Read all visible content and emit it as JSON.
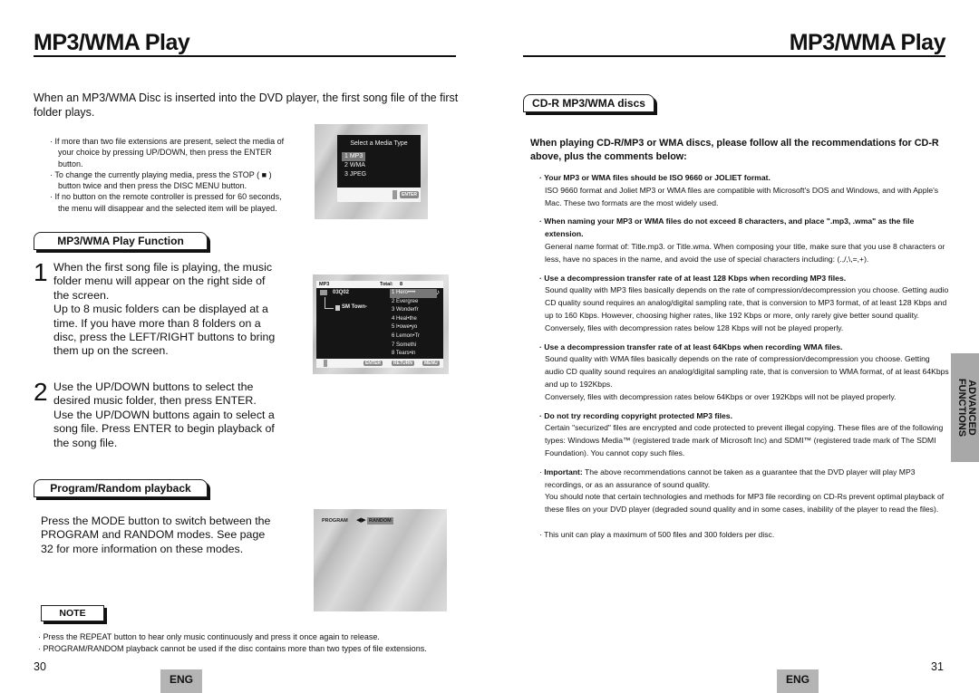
{
  "left_page": {
    "title": "MP3/WMA Play",
    "intro": "When an MP3/WMA Disc is inserted into the DVD player, the first song file of the first folder plays.",
    "bullets": [
      "If more than two file extensions are present, select the media of your choice by pressing UP/DOWN, then press the ENTER button.",
      "To change the currently playing media, press the STOP ( ■ ) button twice and then press the DISC MENU button.",
      "If no button on the remote controller is pressed for 60 seconds, the menu will disappear and the selected item will be played."
    ],
    "media_screen": {
      "heading": "Select a Media Type",
      "options": [
        "1  MP3",
        "2  WMA",
        "3  JPEG"
      ],
      "selected_index": 0,
      "enter_key": "ENTER"
    },
    "section_function": {
      "title": "MP3/WMA Play Function",
      "steps": [
        {
          "num": "1",
          "text": "When the first song file is playing, the music folder menu will appear on the right side of the screen.\nUp to 8 music folders can be displayed at a time. If you have more than 8 folders on a disc, press the LEFT/RIGHT buttons to bring them up on the screen."
        },
        {
          "num": "2",
          "text": "Use the UP/DOWN buttons to select the desired music folder, then press ENTER.\nUse the UP/DOWN buttons again to select a song file. Press ENTER to begin playback of the song file."
        }
      ]
    },
    "folder_screen": {
      "label": "MP3",
      "total_label": "Total:",
      "total_value": "8",
      "folder": "03Q02",
      "subfolder": "SM Town-",
      "tracks": [
        "1 Hero••••",
        "2 Evergree",
        "3 Wonderfr",
        "4 Heal•the",
        "5 I•owe•yo",
        "6 Lemon•Tr",
        "7 Somethi",
        "8 Tears•in"
      ],
      "selected_track": 0,
      "keys": [
        "ENTER",
        "RETURN",
        "MENU"
      ]
    },
    "section_program": {
      "title": "Program/Random playback",
      "text": "Press the MODE button to switch between the PROGRAM and RANDOM modes. See page 32 for more information on these modes."
    },
    "mode_screen": {
      "left_label": "PROGRAM",
      "right_label": "RANDOM",
      "selected": "RANDOM"
    },
    "note": {
      "label": "NOTE",
      "items": [
        "Press the REPEAT button to hear only music continuously and press it once again to release.",
        "PROGRAM/RANDOM playback cannot be used if the disc contains more than two types of file extensions."
      ]
    },
    "page_number": "30",
    "lang_badge": "ENG"
  },
  "right_page": {
    "title": "MP3/WMA Play",
    "section_title": "CD-R MP3/WMA discs",
    "lead": "When playing CD-R/MP3 or WMA discs, please follow all the recommendations for CD-R above, plus the comments below:",
    "items": [
      {
        "head": "Your MP3 or WMA files should be ISO 9660 or JOLIET format.",
        "body": [
          "ISO 9660 format and Joliet MP3 or WMA files are compatible with Microsoft's DOS and Windows, and with Apple's Mac. These two formats are the most widely used."
        ]
      },
      {
        "head": "When naming your MP3 or WMA files do not exceed 8 characters, and place \".mp3, .wma\" as the file extension.",
        "body": [
          "General name format of: Title.mp3. or Title.wma. When composing your title, make sure that you use 8 characters or less, have no spaces in the name, and avoid the use of special characters including: (.,/,\\,=,+)."
        ]
      },
      {
        "head": "Use a decompression transfer rate of at least 128 Kbps when recording MP3 files.",
        "body": [
          "Sound quality with MP3 files basically depends on the rate of compression/decompression you choose. Getting audio CD quality sound requires an analog/digital sampling rate, that is conversion to MP3 format, of at least 128 Kbps and up to 160 Kbps. However, choosing higher rates, like 192 Kbps or more, only rarely give better sound quality.",
          "Conversely, files with decompression rates below 128 Kbps will not be played properly."
        ]
      },
      {
        "head": "Use a decompression transfer rate of at least 64Kbps when recording WMA files.",
        "body": [
          "Sound quality with WMA files basically depends on the rate of compression/decompression you choose. Getting audio CD quality sound requires an analog/digital sampling rate, that is conversion to WMA format, of at least 64Kbps and up to 192Kbps.",
          "Conversely, files with decompression rates  below 64Kbps or over 192Kbps will not be played properly."
        ]
      },
      {
        "head": "Do not try recording copyright protected MP3 files.",
        "body": [
          "Certain \"securized\" files are encrypted and code protected to prevent illegal copying. These files are of the following types: Windows Media™ (registered trade mark of Microsoft Inc) and SDMI™ (registered trade mark of The SDMI Foundation). You cannot copy such files."
        ]
      }
    ],
    "important": {
      "label": "Important:",
      "text": " The above recommendations cannot be taken as a guarantee that the DVD player will play MP3 recordings, or as an assurance of sound quality.",
      "extra": "You should note that certain technologies and methods for MP3 file recording on CD-Rs prevent optimal playback of these files on your DVD player (degraded sound quality and in some cases, inability of the player to read the files)."
    },
    "final_note": "This unit can play a maximum of 500 files and 300 folders per disc.",
    "side_tab": "ADVANCED\nFUNCTIONS",
    "page_number": "31",
    "lang_badge": "ENG"
  }
}
